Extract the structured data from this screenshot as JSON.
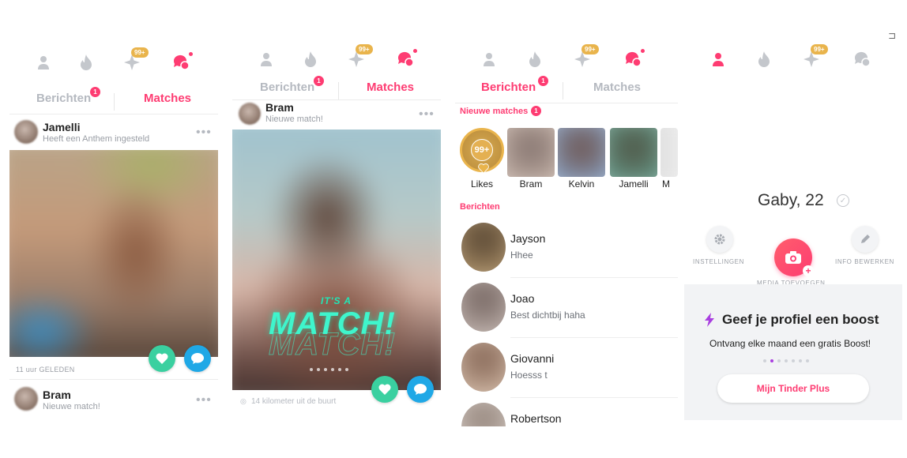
{
  "screen1": {
    "tabs": {
      "berichten": "Berichten",
      "berichten_badge": "1",
      "matches": "Matches"
    },
    "nav_badge": "99+",
    "feed": [
      {
        "name": "Jamelli",
        "sub": "Heeft een Anthem ingesteld"
      },
      {
        "name": "Bram",
        "sub": "Nieuwe match!"
      }
    ],
    "more": "•••",
    "time_ago": "11 uur GELEDEN"
  },
  "screen2": {
    "nav_badge": "99+",
    "tabs": {
      "berichten": "Berichten",
      "berichten_badge": "1",
      "matches": "Matches"
    },
    "card": {
      "name": "Bram",
      "sub": "Nieuwe match!"
    },
    "more": "•••",
    "its_a": "IT'S A",
    "match_text": "MATCH!",
    "distance": "14 kilometer uit de buurt"
  },
  "screen3": {
    "nav_badge": "99+",
    "tabs": {
      "berichten": "Berichten",
      "berichten_badge": "1",
      "matches": "Matches"
    },
    "new_matches_label": "Nieuwe matches",
    "new_matches_badge": "1",
    "likes_badge": "99+",
    "matches": [
      {
        "name": "Likes"
      },
      {
        "name": "Bram"
      },
      {
        "name": "Kelvin"
      },
      {
        "name": "Jamelli"
      },
      {
        "name": "M"
      }
    ],
    "messages_label": "Berichten",
    "messages": [
      {
        "name": "Jayson",
        "text": "Hhee"
      },
      {
        "name": "Joao",
        "text": "Best dichtbij haha"
      },
      {
        "name": "Giovanni",
        "text": "Hoesss t"
      },
      {
        "name": "Robertson",
        "text": ""
      }
    ]
  },
  "screen4": {
    "nav_badge": "99+",
    "profile_name": "Gaby, 22",
    "settings_label": "INSTELLINGEN",
    "media_label": "MEDIA TOEVOEGEN",
    "edit_label": "INFO BEWERKEN",
    "boost_title": "Geef je profiel een boost",
    "boost_sub": "Ontvang elke maand een gratis Boost!",
    "plus_button": "Mijn Tinder Plus"
  },
  "colors": {
    "accent": "#fe3c72",
    "muted": "#b5b9c0",
    "gold": "#e9b44c",
    "green": "#3ad0a0",
    "blue": "#1fa8e6"
  },
  "icons": [
    "person-icon",
    "flame-icon",
    "sparkle-icon",
    "chat-bubbles-icon",
    "heart-icon",
    "chat-icon",
    "gear-icon",
    "camera-icon",
    "pencil-icon",
    "bolt-icon",
    "verified-check-icon",
    "exit-icon",
    "location-pin-icon"
  ]
}
